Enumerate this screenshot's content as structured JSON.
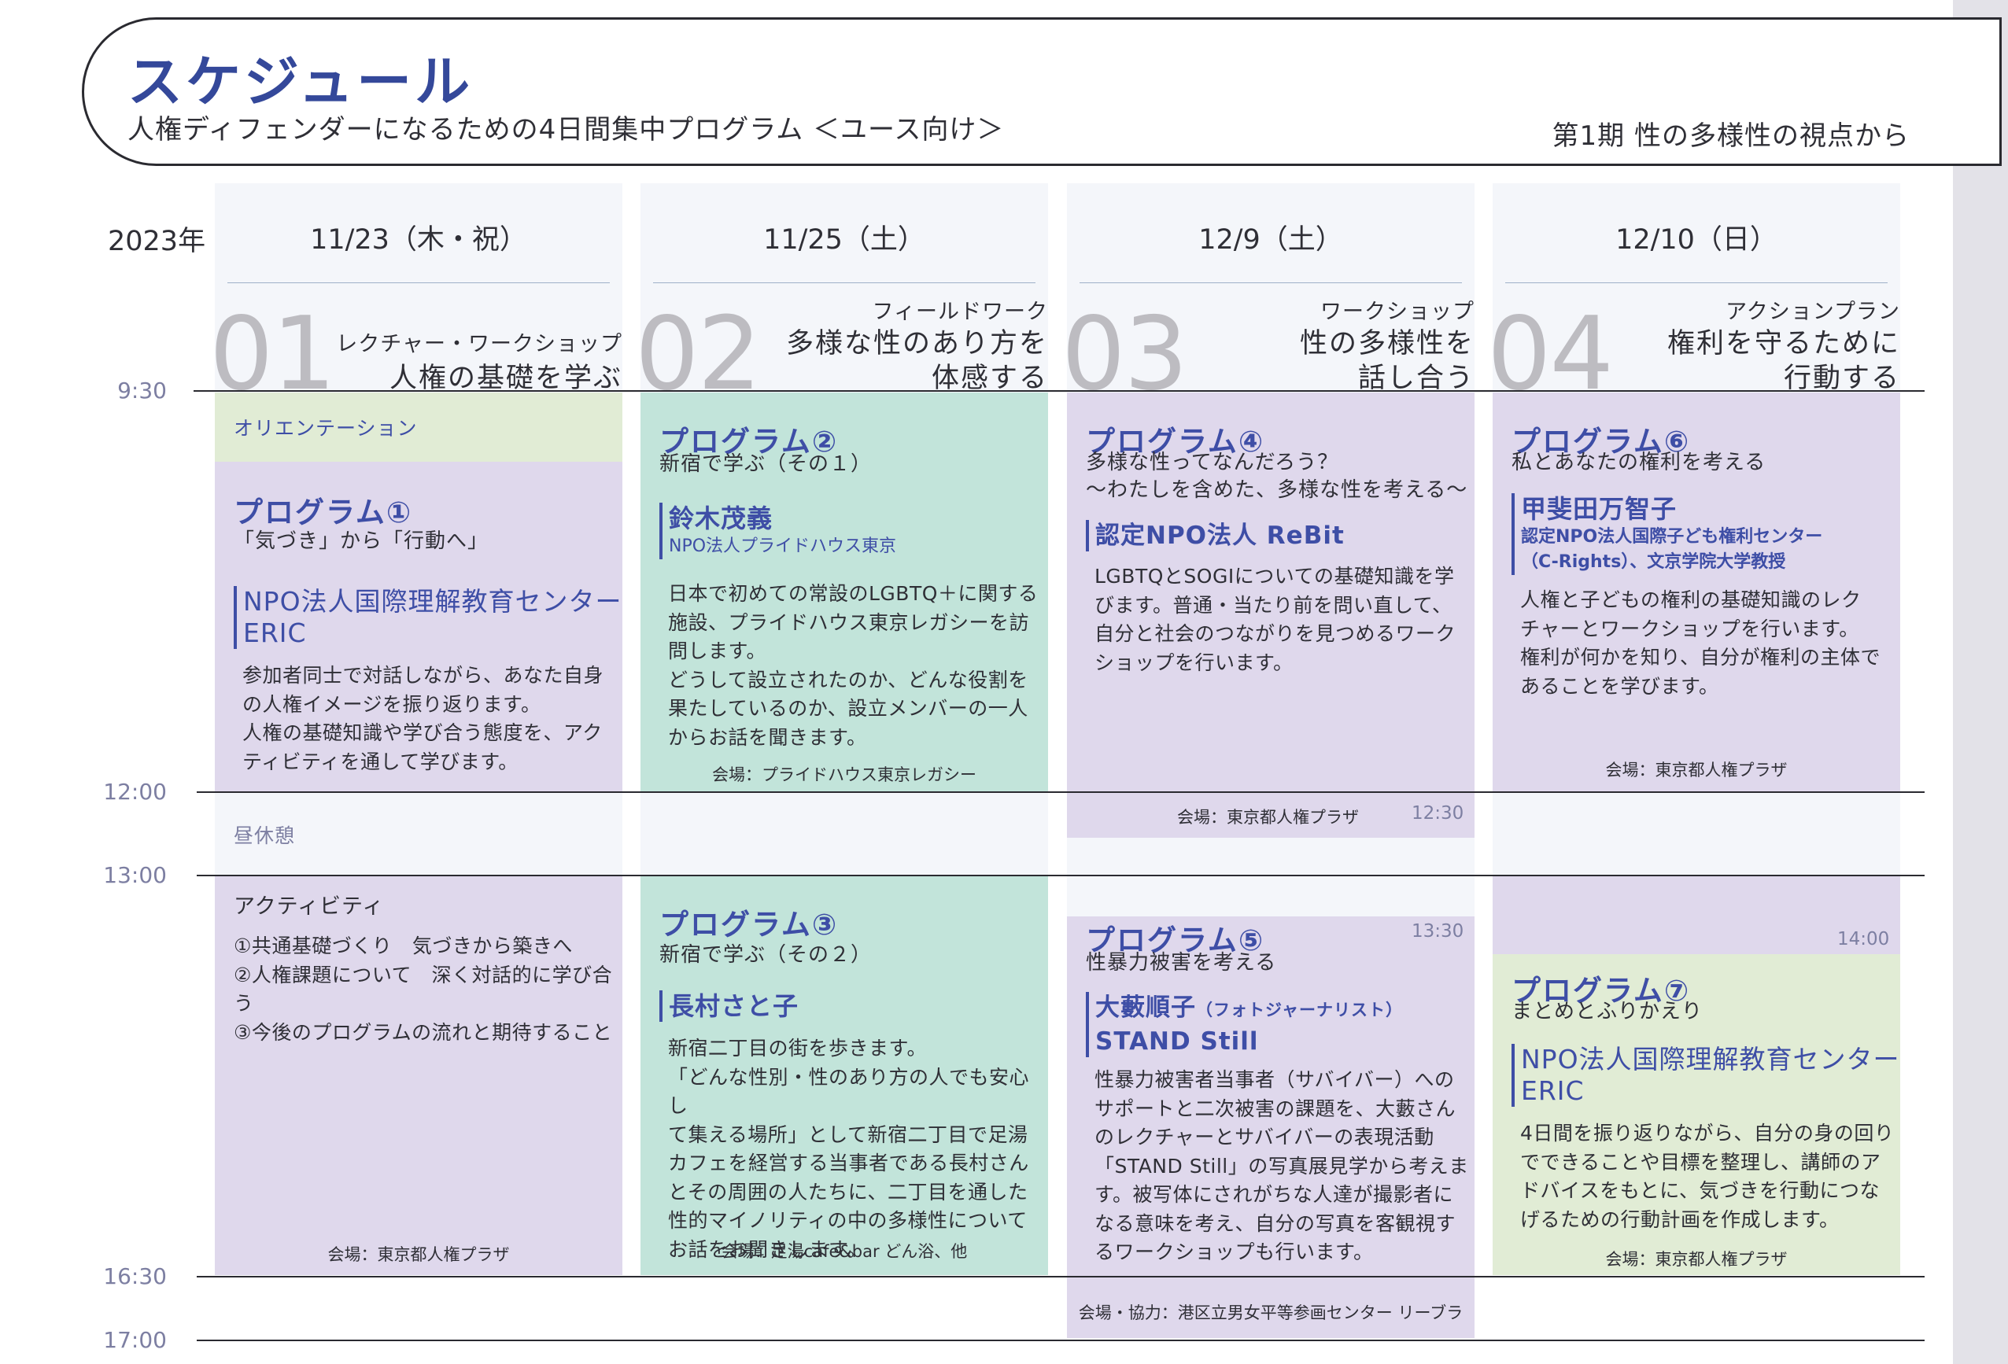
{
  "header": {
    "title": "スケジュール",
    "subtitle": "人権ディフェンダーになるための4日間集中プログラム ＜ユース向け＞",
    "period": "第1期 性の多様性の視点から"
  },
  "year": "2023年",
  "times": {
    "t0930": "9:30",
    "t1200": "12:00",
    "t1300": "13:00",
    "t1630": "16:30",
    "t1700": "17:00"
  },
  "days": [
    {
      "date": "11/23（木・祝）",
      "num": "01",
      "type": "レクチャー・ワークショップ",
      "title1": "人権の基礎を学ぶ"
    },
    {
      "date": "11/25（土）",
      "num": "02",
      "type": "フィールドワーク",
      "title1": "多様な性のあり方を",
      "title2": "体感する"
    },
    {
      "date": "12/9（土）",
      "num": "03",
      "type": "ワークショップ",
      "title1": "性の多様性を",
      "title2": "話し合う"
    },
    {
      "date": "12/10（日）",
      "num": "04",
      "type": "アクションプラン",
      "title1": "権利を守るために",
      "title2": "行動する"
    }
  ],
  "d1": {
    "orientation": "オリエンテーション",
    "p1_title": "プログラム①",
    "p1_sub": "「気づき」から「行動へ」",
    "p1_org1": "NPO法人国際理解教育センター",
    "p1_org2": "ERIC",
    "p1_desc": [
      "参加者同士で対話しながら、あなた自身",
      "の人権イメージを振り返ります。",
      "人権の基礎知識や学び合う態度を、アク",
      "ティビティを通して学びます。"
    ],
    "lunch": "昼休憩",
    "act_title": "アクティビティ",
    "act_items": [
      "①共通基礎づくり　気づきから築きへ",
      "②人権課題について　深く対話的に学び合う",
      "③今後のプログラムの流れと期待すること"
    ],
    "venue": "会場：東京都人権プラザ"
  },
  "d2": {
    "p2_title": "プログラム②",
    "p2_sub": "新宿で学ぶ（その１）",
    "p2_name": "鈴木茂義",
    "p2_aff": "NPO法人プライドハウス東京",
    "p2_desc": [
      "日本で初めての常設のLGBTQ＋に関する",
      "施設、プライドハウス東京レガシーを訪",
      "問します。",
      "どうして設立されたのか、どんな役割を",
      "果たしているのか、設立メンバーの一人",
      "からお話を聞きます。"
    ],
    "p2_venue": "会場：プライドハウス東京レガシー",
    "p3_title": "プログラム③",
    "p3_sub": "新宿で学ぶ（その２）",
    "p3_name": "長村さと子",
    "p3_desc": [
      "新宿二丁目の街を歩きます。",
      "「どんな性別・性のあり方の人でも安心し",
      "て集える場所」として新宿二丁目で足湯",
      "カフェを経営する当事者である長村さん",
      "とその周囲の人たちに、二丁目を通した",
      "性的マイノリティの中の多様性について",
      "お話をお聞きします。"
    ],
    "p3_venue": "会場：足湯cafe&bar どん浴、他"
  },
  "d3": {
    "p4_title": "プログラム④",
    "p4_sub1": "多様な性ってなんだろう？",
    "p4_sub2": "〜わたしを含めた、多様な性を考える〜",
    "p4_org": "認定NPO法人 ReBit",
    "p4_desc": [
      "LGBTQとSOGIについての基礎知識を学",
      "びます。普通・当たり前を問い直して、",
      "自分と社会のつながりを見つめるワーク",
      "ショップを行います。"
    ],
    "p4_venue": "会場：東京都人権プラザ",
    "p4_end": "12:30",
    "p5_start": "13:30",
    "p5_title": "プログラム⑤",
    "p5_sub": "性暴力被害を考える",
    "p5_name": "大藪順子",
    "p5_role": "（フォトジャーナリスト）",
    "p5_org": "STAND Still",
    "p5_desc": [
      "性暴力被害者当事者（サバイバー）への",
      "サポートと二次被害の課題を、大藪さん",
      "のレクチャーとサバイバーの表現活動",
      "「STAND Still」の写真展見学から考えま",
      "す。被写体にされがちな人達が撮影者に",
      "なる意味を考え、自分の写真を客観視す",
      "るワークショップも行います。"
    ],
    "p5_venue": "会場・協力：港区立男女平等参画センター リーブラ"
  },
  "d4": {
    "p6_title": "プログラム⑥",
    "p6_sub": "私とあなたの権利を考える",
    "p6_name": "甲斐田万智子",
    "p6_aff1": "認定NPO法人国際子ども権利センター",
    "p6_aff2": "（C-Rights）、文京学院大学教授",
    "p6_desc": [
      "人権と子どもの権利の基礎知識のレク",
      "チャーとワークショップを行います。",
      "権利が何かを知り、自分が権利の主体で",
      "あることを学びます。"
    ],
    "p6_venue": "会場：東京都人権プラザ",
    "p7_start": "14:00",
    "p7_title": "プログラム⑦",
    "p7_sub": "まとめとふりかえり",
    "p7_org1": "NPO法人国際理解教育センター",
    "p7_org2": "ERIC",
    "p7_desc": [
      "4日間を振り返りながら、自分の身の回り",
      "でできることや目標を整理し、講師のア",
      "ドバイスをもとに、気づきを行動につな",
      "げるための行動計画を作成します。"
    ],
    "p7_venue": "会場：東京都人権プラザ"
  }
}
